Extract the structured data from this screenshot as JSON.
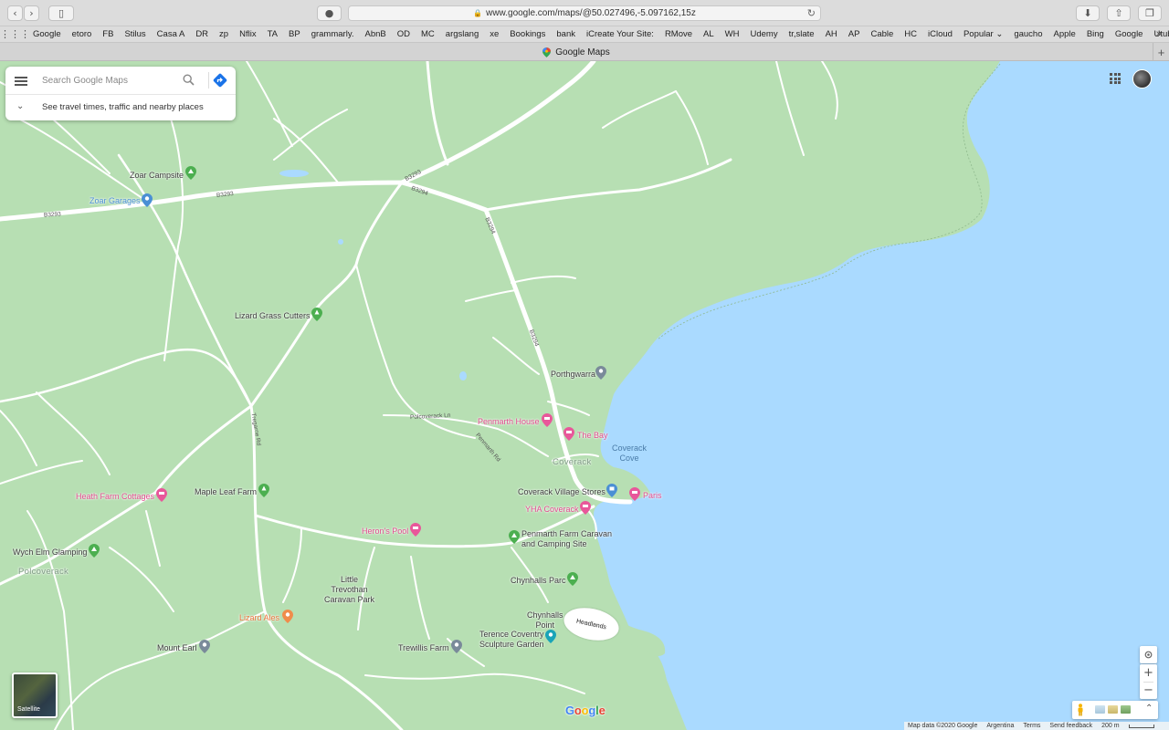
{
  "browser": {
    "url": "www.google.com/maps/@50.027496,-5.097162,15z",
    "tab_title": "Google Maps",
    "bookmarks": [
      "Google",
      "etoro",
      "FB",
      "Stilus",
      "Casa A",
      "DR",
      "zp",
      "Nflix",
      "TA",
      "BP",
      "grammarly.",
      "AbnB",
      "OD",
      "MC",
      "argslang",
      "xe",
      "Bookings",
      "bank",
      "iCreate Your Site:",
      "RMove",
      "AL",
      "WH",
      "Udemy",
      "tr,slate",
      "AH",
      "AP",
      "Cable",
      "HC",
      "iCloud",
      "Popular",
      "gaucho",
      "Apple",
      "Bing",
      "Google",
      "Utube"
    ]
  },
  "search": {
    "placeholder": "Search Google Maps",
    "hint": "See travel times, traffic and nearby places"
  },
  "map": {
    "places": {
      "zoar_campsite": "Zoar Campsite",
      "zoar_garages": "Zoar Garages",
      "lizard_grass_cutters": "Lizard Grass Cutters",
      "porthgwarra": "Porthgwarra",
      "penmarth_house": "Penmarth House",
      "the_bay": "The Bay",
      "coverack_cove": "Coverack\nCove",
      "coverack": "Coverack",
      "coverack_village_stores": "Coverack Village Stores",
      "paris": "Paris",
      "yha_coverack": "YHA Coverack",
      "heath_farm_cottages": "Heath Farm Cottages",
      "maple_leaf_farm": "Maple Leaf Farm",
      "herons_pool": "Heron's Pool",
      "penmarth_farm": "Penmarth Farm Caravan\nand Camping Site",
      "wych_elm_glamping": "Wych Elm Glamping",
      "polcoverack": "Polcoverack",
      "little_trevothan": "Little\nTrevothan\nCaravan Park",
      "chynhalls_parc": "Chynhalls Parc",
      "chynhalls_point": "Chynhalls\nPoint",
      "headlands": "Headlands",
      "lizard_ales": "Lizard Ales",
      "terence_coventry": "Terence Coventry\nSculpture Garden",
      "mount_earl": "Mount Earl",
      "trewillis_farm": "Trewillis Farm"
    },
    "roads": {
      "b3293_a": "B3293",
      "b3293_b": "B3293",
      "b3293_c": "B3293",
      "b3294_a": "B3294",
      "b3294_b": "B3294",
      "b3294_c": "B3294",
      "polcoverack_ln": "Polcoverack Ln",
      "penmarth_rd": "Penmarth Rd",
      "tregarne_rd": "Tregarne Rd"
    },
    "satellite_label": "Satellite"
  },
  "footer": {
    "map_data": "Map data ©2020 Google",
    "region": "Argentina",
    "terms": "Terms",
    "feedback": "Send feedback",
    "scale": "200 m"
  },
  "logo": {
    "g1": "G",
    "o1": "o",
    "o2": "o",
    "g2": "g",
    "l": "l",
    "e": "e"
  },
  "colors": {
    "land": "#b7dfb3",
    "water": "#aadaff",
    "road": "#ffffff",
    "pin_green": "#4caf50",
    "pin_pink": "#e8579a",
    "pin_blue": "#4a8fd4",
    "pin_grey": "#7a8a9a",
    "pin_orange": "#f08c4b",
    "pin_teal": "#1aa4b8"
  }
}
